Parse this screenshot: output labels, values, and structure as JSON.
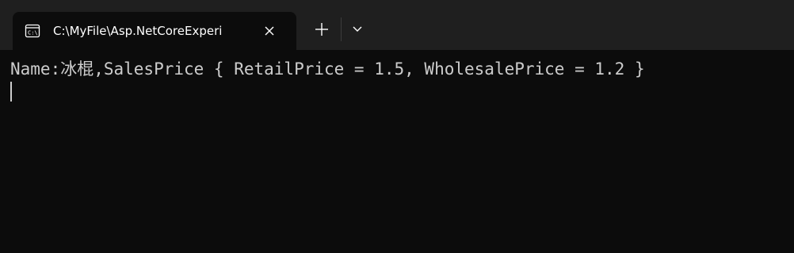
{
  "tab": {
    "title": "C:\\MyFile\\Asp.NetCoreExperi",
    "icon": "terminal-icon",
    "close_icon": "close-icon"
  },
  "titlebar": {
    "new_tab_icon": "plus-icon",
    "dropdown_icon": "chevron-down-icon"
  },
  "terminal": {
    "output": "Name:冰棍,SalesPrice { RetailPrice = 1.5, WholesalePrice = 1.2 }"
  },
  "colors": {
    "background": "#0c0c0c",
    "titlebar": "#1f1f1f",
    "text": "#cccccc"
  }
}
